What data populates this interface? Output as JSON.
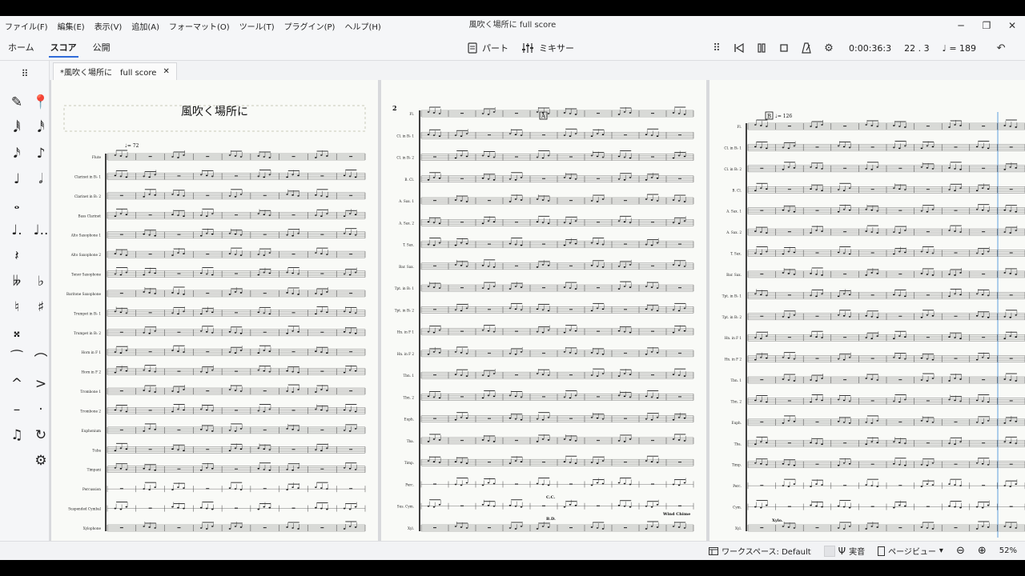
{
  "menu": [
    "ファイル(F)",
    "編集(E)",
    "表示(V)",
    "追加(A)",
    "フォーマット(O)",
    "ツール(T)",
    "プラグイン(P)",
    "ヘルプ(H)"
  ],
  "window_title": "風吹く場所に full score",
  "tabs": [
    "ホーム",
    "スコア",
    "公開"
  ],
  "active_tab": "スコア",
  "toolbar_center": {
    "parts": "パート",
    "mixer": "ミキサー"
  },
  "playback": {
    "time": "0:00:36:3",
    "position": "22 . 3",
    "tempo": "= 189"
  },
  "document_tab": "*風吹く場所に　full score",
  "statusbar": {
    "workspace": "ワークスペース: Default",
    "concert_pitch": "実音",
    "view_mode": "ページビュー",
    "zoom": "52%"
  },
  "page1": {
    "title": "風吹く場所に",
    "tempo_mark": "♩= 72",
    "instruments": [
      "Flute",
      "Clarinet in B♭ 1",
      "Clarinet in B♭ 2",
      "Bass Clarinet",
      "Alto Saxophone 1",
      "Alto Saxophone 2",
      "Tenor Saxophone",
      "Baritone Saxophone",
      "Trumpet in B♭ 1",
      "Trumpet in B♭ 2",
      "Horn in F 1",
      "Horn in F 2",
      "Trombone 1",
      "Trombone 2",
      "Euphonium",
      "Tuba",
      "Timpani",
      "Percussion",
      "Suspended Cymbal",
      "Xylophone"
    ]
  },
  "page2": {
    "number": "2",
    "rehearsal": "A",
    "instruments": [
      "Fl.",
      "Cl. in B♭ 1",
      "Cl. in B♭ 2",
      "B. Cl.",
      "A. Sax. 1",
      "A. Sax. 2",
      "T. Sax.",
      "Bar. Sax.",
      "Tpt. in B♭ 1",
      "Tpt. in B♭ 2",
      "Hn. in F 1",
      "Hn. in F 2",
      "Tbn. 1",
      "Tbn. 2",
      "Euph.",
      "Tba.",
      "Timp.",
      "Perc.",
      "Sus. Cym.",
      "Xyl."
    ],
    "annotations": {
      "cc": "C.C.",
      "bd": "B.D.",
      "wind_chime": "Wind Chime"
    }
  },
  "page3": {
    "rehearsal": "B",
    "tempo_mark": "♩= 126",
    "instruments": [
      "Fl.",
      "Cl. in B♭ 1",
      "Cl. in B♭ 2",
      "B. Cl.",
      "A. Sax. 1",
      "A. Sax. 2",
      "T. Sax.",
      "Bar. Sax.",
      "Tpt. in B♭ 1",
      "Tpt. in B♭ 2",
      "Hn. in F 1",
      "Hn. in F 2",
      "Tbn. 1",
      "Tbn. 2",
      "Euph.",
      "Tba.",
      "Timp.",
      "Perc.",
      "Cym.",
      "Xyl."
    ],
    "annotations": {
      "xylo": "Xylo."
    }
  }
}
